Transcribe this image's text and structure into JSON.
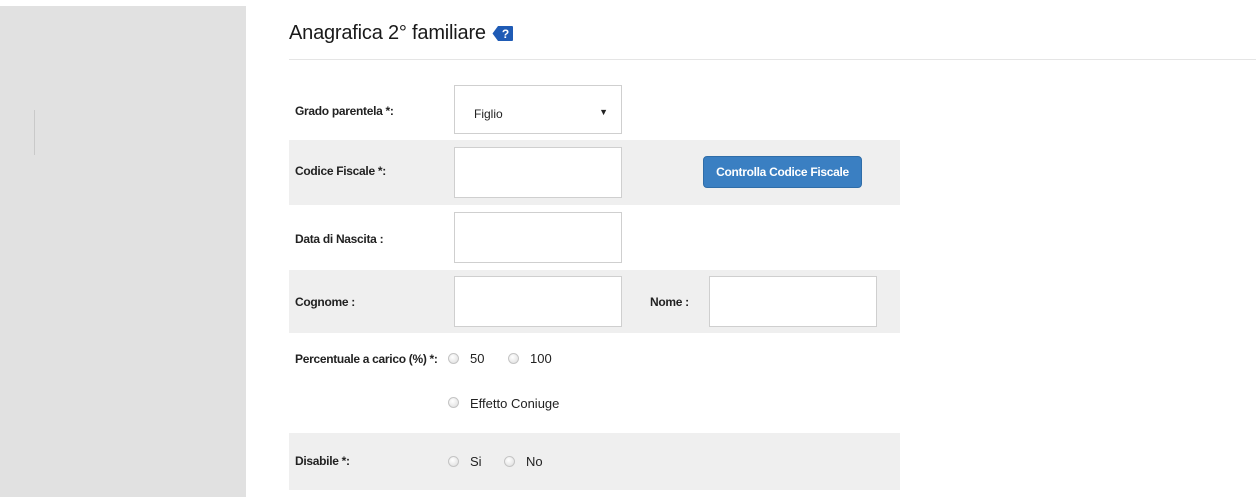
{
  "page": {
    "title": "Anagrafica 2° familiare",
    "help_icon": "help-tag-icon"
  },
  "form": {
    "grado_parentela": {
      "label": "Grado parentela *:",
      "value": "Figlio"
    },
    "codice_fiscale": {
      "label": "Codice Fiscale *:",
      "value": "",
      "button": "Controlla Codice Fiscale"
    },
    "data_nascita": {
      "label": "Data di Nascita :",
      "value": ""
    },
    "cognome": {
      "label": "Cognome :",
      "value": ""
    },
    "nome": {
      "label": "Nome :",
      "value": ""
    },
    "percentuale": {
      "label": "Percentuale a carico (%) *:",
      "options": [
        "50",
        "100",
        "Effetto Coniuge"
      ]
    },
    "disabile": {
      "label": "Disabile *:",
      "options": [
        "Si",
        "No"
      ]
    }
  },
  "colors": {
    "accent": "#3a7fc2",
    "help_tag": "#1f5bb5",
    "sidebar": "#e1e1e1",
    "row_shade": "#efefef"
  }
}
